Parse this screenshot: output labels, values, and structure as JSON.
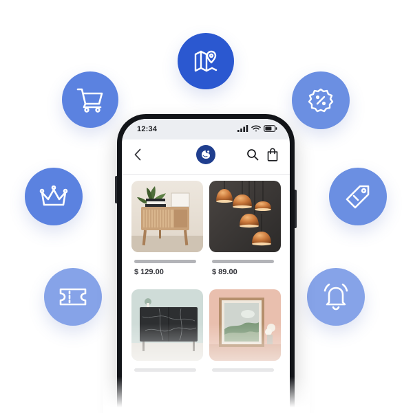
{
  "status_bar": {
    "time": "12:34"
  },
  "header": {
    "back_icon": "chevron-left-icon",
    "logo_icon": "brand-logo-icon",
    "search_icon": "search-icon",
    "bag_icon": "shopping-bag-icon"
  },
  "products": [
    {
      "price": "$ 129.00",
      "image": "nightstand-photo"
    },
    {
      "price": "$ 89.00",
      "image": "pendant-lamps-photo"
    },
    {
      "price": "",
      "image": "marble-cabinet-photo"
    },
    {
      "price": "",
      "image": "framed-art-photo"
    }
  ],
  "features": [
    {
      "icon": "map-pin-icon",
      "color": "#2b58d0"
    },
    {
      "icon": "shopping-cart-icon",
      "color": "#5b82e0"
    },
    {
      "icon": "discount-badge-icon",
      "color": "#6b8fe2"
    },
    {
      "icon": "crown-icon",
      "color": "#5b82e0"
    },
    {
      "icon": "price-tag-icon",
      "color": "#6b8fe2"
    },
    {
      "icon": "ticket-icon",
      "color": "#86a3e8"
    },
    {
      "icon": "bell-icon",
      "color": "#86a3e8"
    }
  ]
}
